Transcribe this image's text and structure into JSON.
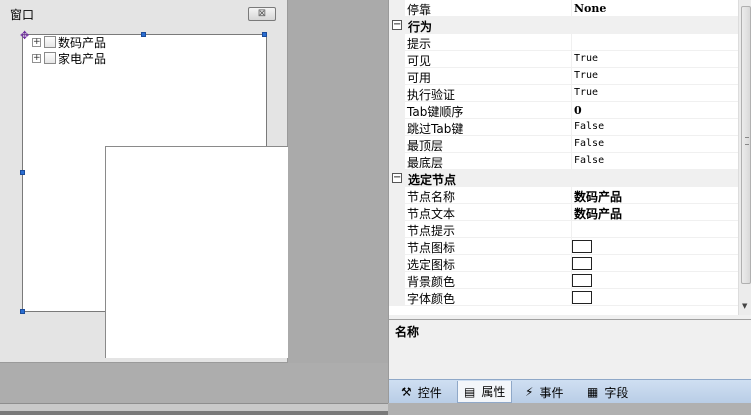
{
  "designer": {
    "title": "窗口",
    "close_label": "⊠",
    "move_icon": "move-arrows-icon",
    "tree": [
      {
        "label": "数码产品",
        "expander": "+"
      },
      {
        "label": "家电产品",
        "expander": "+"
      }
    ]
  },
  "properties": {
    "rows": [
      {
        "type": "prop",
        "name": "停靠",
        "value": "None",
        "style": "bold"
      },
      {
        "type": "cat",
        "name": "行为",
        "toggle": "−"
      },
      {
        "type": "prop",
        "name": "提示",
        "value": ""
      },
      {
        "type": "prop",
        "name": "可见",
        "value": "True"
      },
      {
        "type": "prop",
        "name": "可用",
        "value": "True"
      },
      {
        "type": "prop",
        "name": "执行验证",
        "value": "True"
      },
      {
        "type": "prop",
        "name": "Tab键顺序",
        "value": "0",
        "style": "bold"
      },
      {
        "type": "prop",
        "name": "跳过Tab键",
        "value": "False"
      },
      {
        "type": "prop",
        "name": "最顶层",
        "value": "False"
      },
      {
        "type": "prop",
        "name": "最底层",
        "value": "False"
      },
      {
        "type": "cat",
        "name": "选定节点",
        "toggle": "−"
      },
      {
        "type": "prop",
        "name": "节点名称",
        "value": "数码产品",
        "style": "boldcjk"
      },
      {
        "type": "prop",
        "name": "节点文本",
        "value": "数码产品",
        "style": "boldcjk"
      },
      {
        "type": "prop",
        "name": "节点提示",
        "value": ""
      },
      {
        "type": "prop",
        "name": "节点图标",
        "value": "",
        "style": "swatch"
      },
      {
        "type": "prop",
        "name": "选定图标",
        "value": "",
        "style": "swatch"
      },
      {
        "type": "prop",
        "name": "背景颜色",
        "value": "",
        "style": "swatch"
      },
      {
        "type": "prop",
        "name": "字体颜色",
        "value": "",
        "style": "swatch"
      }
    ],
    "description_title": "名称"
  },
  "tabs": [
    {
      "label": "控件",
      "icon": "tools-icon",
      "glyph": "⚒",
      "active": false
    },
    {
      "label": "属性",
      "icon": "properties-icon",
      "glyph": "▤",
      "active": true
    },
    {
      "label": "事件",
      "icon": "lightning-icon",
      "glyph": "⚡",
      "active": false
    },
    {
      "label": "字段",
      "icon": "fields-icon",
      "glyph": "▦",
      "active": false
    }
  ],
  "colors": {
    "accent": "#2a6ed2",
    "tab_bar": "#b9cde6"
  }
}
